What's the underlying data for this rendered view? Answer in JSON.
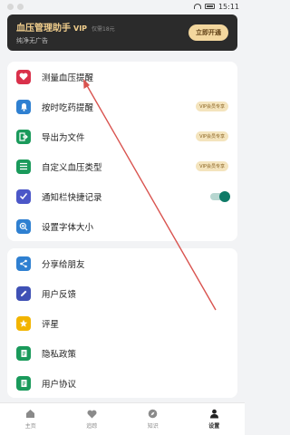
{
  "status_bar": {
    "time": "15:11"
  },
  "vip": {
    "title": "血压管理助手",
    "badge": "VIP",
    "price_note": "仅需18元",
    "subtitle": "纯净无广告",
    "button": "立即开通"
  },
  "menu_group1": [
    {
      "label": "测量血压提醒",
      "icon": "heart-icon",
      "color": "#d9314b",
      "tag": ""
    },
    {
      "label": "按时吃药提醒",
      "icon": "bell-icon",
      "color": "#2f80d1",
      "tag": "VIP会员专享"
    },
    {
      "label": "导出为文件",
      "icon": "export-icon",
      "color": "#1a9a5b",
      "tag": "VIP会员专享"
    },
    {
      "label": "自定义血压类型",
      "icon": "list-icon",
      "color": "#1a9a5b",
      "tag": "VIP会员专享"
    },
    {
      "label": "通知栏快捷记录",
      "icon": "checkbox-icon",
      "color": "#4b57c8",
      "tag": ""
    },
    {
      "label": "设置字体大小",
      "icon": "zoom-icon",
      "color": "#2f80d1",
      "tag": ""
    }
  ],
  "notification_toggle": {
    "on": true,
    "color": "#0e7a67"
  },
  "menu_group2": [
    {
      "label": "分享给朋友",
      "icon": "share-icon",
      "color": "#2f80d1"
    },
    {
      "label": "用户反馈",
      "icon": "pencil-icon",
      "color": "#3f51b5"
    },
    {
      "label": "评星",
      "icon": "star-icon",
      "color": "#f2b400"
    },
    {
      "label": "隐私政策",
      "icon": "document-icon",
      "color": "#1a9a5b"
    },
    {
      "label": "用户协议",
      "icon": "document-icon",
      "color": "#1a9a5b"
    }
  ],
  "tabs": [
    {
      "label": "主页",
      "icon": "home-icon",
      "active": false
    },
    {
      "label": "追踪",
      "icon": "heart-icon",
      "active": false
    },
    {
      "label": "知识",
      "icon": "compass-icon",
      "active": false
    },
    {
      "label": "设置",
      "icon": "person-icon",
      "active": true
    }
  ],
  "annotation": {
    "color": "#d9534f"
  }
}
